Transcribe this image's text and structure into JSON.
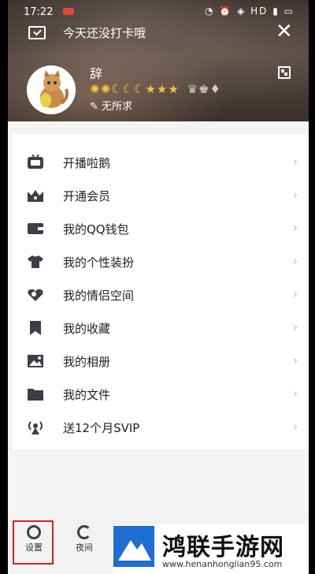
{
  "status_bar": {
    "time": "17:22",
    "icons": "◔ ⏰ ◈ HD ▮ ▭"
  },
  "header": {
    "checkin_text": "今天还没打卡哦",
    "username": "辞",
    "level_badges": "✺✺☾☾☾★★★",
    "vip_badges": "♛♚♦",
    "signature": "✎ 无所求"
  },
  "menu": {
    "items": [
      {
        "label": "开播啦鹅",
        "icon": "live-icon"
      },
      {
        "label": "开通会员",
        "icon": "crown-icon"
      },
      {
        "label": "我的QQ钱包",
        "icon": "wallet-icon"
      },
      {
        "label": "我的个性装扮",
        "icon": "shirt-icon"
      },
      {
        "label": "我的情侣空间",
        "icon": "heart-icon"
      },
      {
        "label": "我的收藏",
        "icon": "bookmark-icon"
      },
      {
        "label": "我的相册",
        "icon": "photo-icon"
      },
      {
        "label": "我的文件",
        "icon": "folder-icon"
      },
      {
        "label": "送12个月SVIP",
        "icon": "signal-icon"
      }
    ],
    "arrow": "›"
  },
  "bottom_bar": {
    "tabs": [
      {
        "label": "设置",
        "icon": "settings-icon"
      },
      {
        "label": "夜间",
        "icon": "moon-icon"
      }
    ]
  },
  "watermark": {
    "title": "鸿联手游网",
    "url": "www.henanhonglian95.com"
  },
  "colors": {
    "icon": "#3c3f47",
    "highlight": "#d1241d",
    "logo": "#1e6dd2"
  }
}
